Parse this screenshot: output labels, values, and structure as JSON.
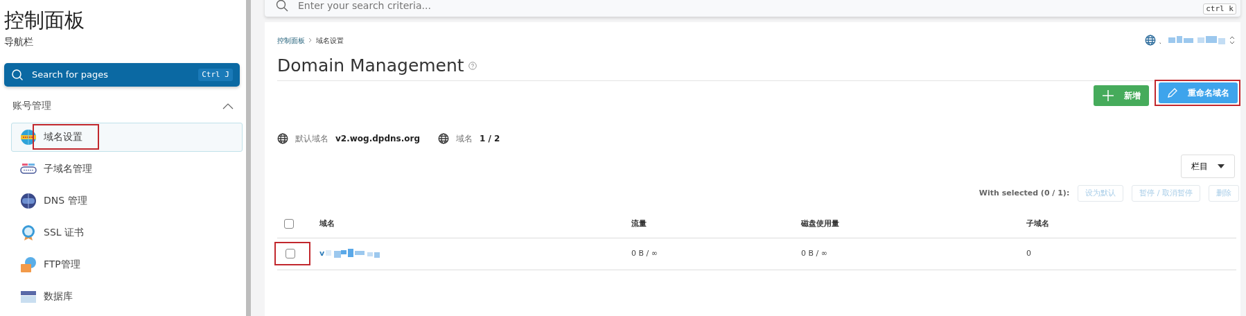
{
  "sidebar": {
    "title": "控制面板",
    "subtitle": "导航栏",
    "search": {
      "label": "Search for pages",
      "shortcut": "Ctrl J"
    },
    "section": {
      "label": "账号管理",
      "expanded": true
    },
    "items": [
      {
        "label": "域名设置",
        "kind": "globe",
        "selected": true,
        "marked": true
      },
      {
        "label": "子域名管理",
        "kind": "strip",
        "selected": false,
        "marked": false
      },
      {
        "label": "DNS 管理",
        "kind": "dns",
        "selected": false,
        "marked": false
      },
      {
        "label": "SSL 证书",
        "kind": "ssl",
        "selected": false,
        "marked": false
      },
      {
        "label": "FTP管理",
        "kind": "ftp",
        "selected": false,
        "marked": false
      },
      {
        "label": "数据库",
        "kind": "db",
        "selected": false,
        "marked": false
      }
    ]
  },
  "top_search": {
    "placeholder": "Enter your search criteria...",
    "shortcut": "ctrl k"
  },
  "breadcrumb": [
    {
      "label": "控制面板",
      "link": true
    },
    {
      "label": "域名设置",
      "link": false
    }
  ],
  "account_switch": {
    "separator": "、"
  },
  "title": "Domain Management",
  "actions": [
    {
      "label": "新增",
      "kind": "add",
      "marked": false
    },
    {
      "label": "重命名域名",
      "kind": "rename",
      "marked": true
    }
  ],
  "info": [
    {
      "label": "默认域名",
      "value": "v2.wog.dpdns.org"
    },
    {
      "label": "域名",
      "value": "1 / 2"
    }
  ],
  "columns_button": "栏目",
  "bulk": {
    "label": "With selected (0 / 1):",
    "buttons": [
      {
        "label": "设为默认",
        "disabled": true
      },
      {
        "label": "暂停 / 取消暂停",
        "disabled": true
      },
      {
        "label": "删除",
        "disabled": true
      }
    ]
  },
  "table": {
    "select_all": {
      "checked": false
    },
    "columns": [
      "域名",
      "流量",
      "磁盘使用量",
      "子域名"
    ],
    "rows": [
      {
        "checked": false,
        "marked": true,
        "domain": "v",
        "traffic": "0 B / ∞",
        "disk": "0 B / ∞",
        "subdomains": "0"
      }
    ]
  }
}
